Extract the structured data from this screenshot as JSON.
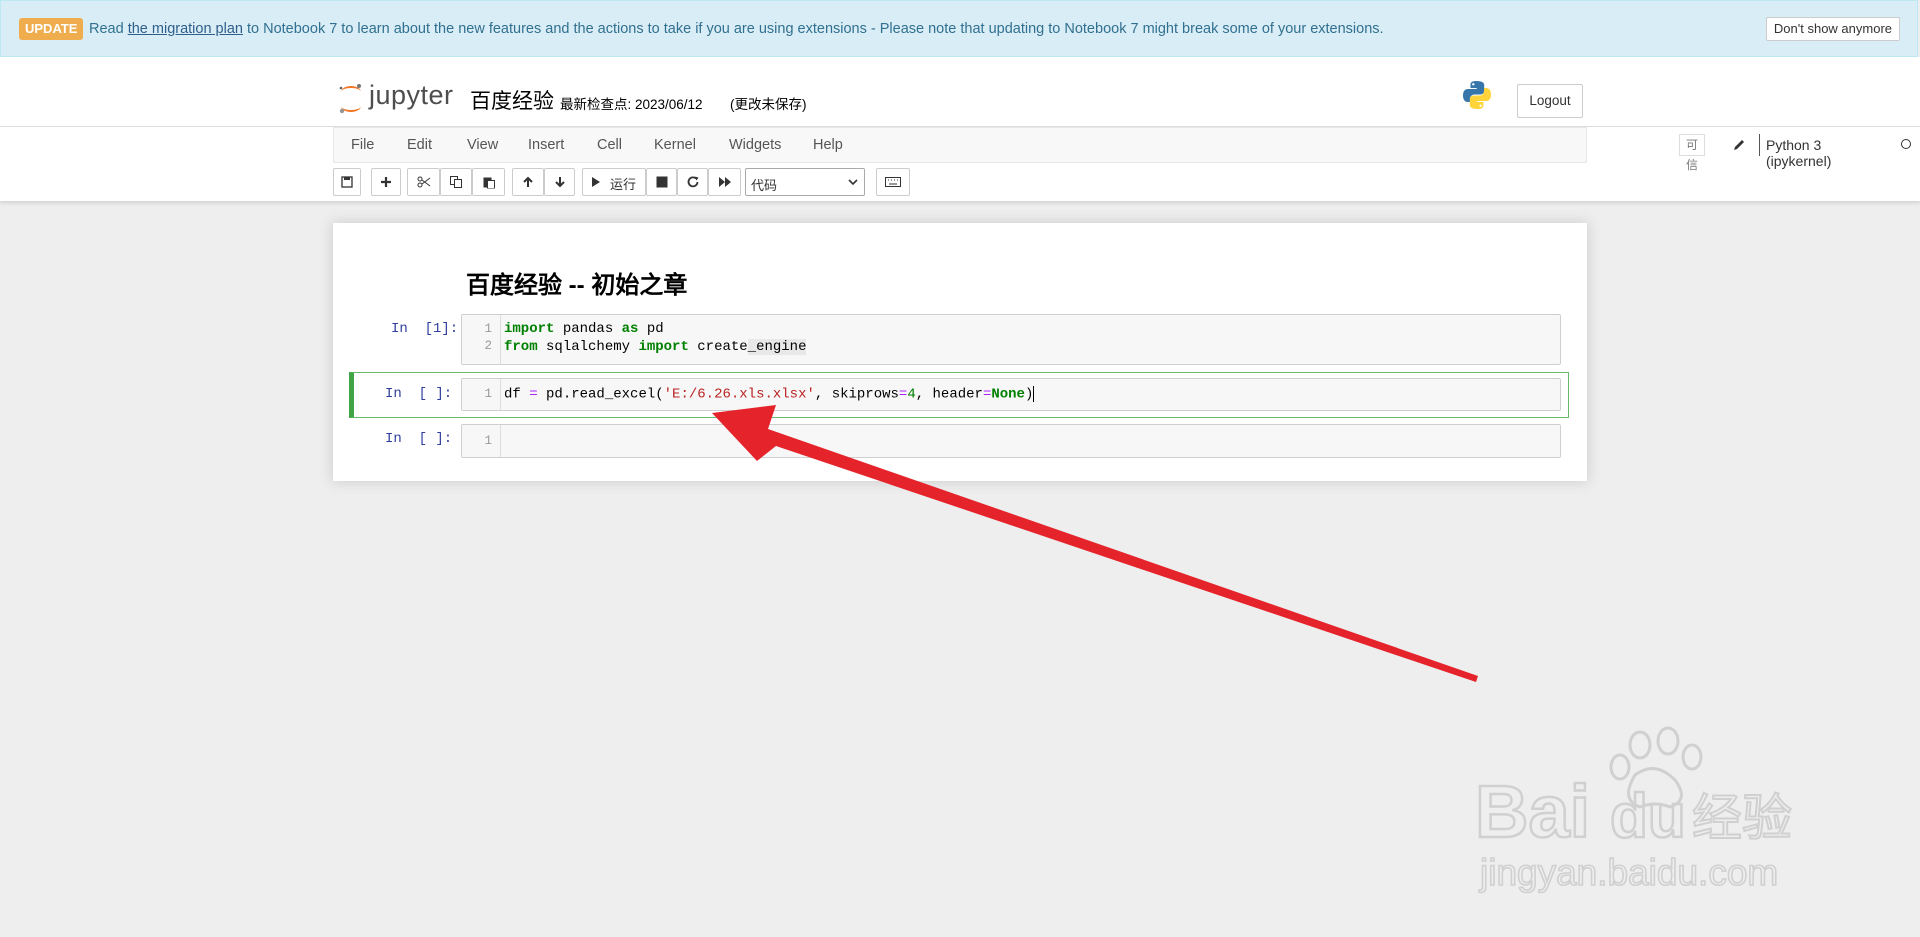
{
  "banner": {
    "badge": "UPDATE",
    "pre": "Read ",
    "link": "the migration plan",
    "post": " to Notebook 7 to learn about the new features and the actions to take if you are using extensions - Please note that updating to Notebook 7 might break some of your extensions.",
    "dismiss": "Don't show anymore"
  },
  "header": {
    "logo_text": "jupyter",
    "notebook_title": "百度经验",
    "checkpoint": "最新检查点: 2023/06/12",
    "unsaved": "(更改未保存)",
    "logout": "Logout"
  },
  "menu": {
    "items": [
      "File",
      "Edit",
      "View",
      "Insert",
      "Cell",
      "Kernel",
      "Widgets",
      "Help"
    ],
    "trusted": "可信",
    "kernel": "Python 3 (ipykernel)"
  },
  "toolbar": {
    "run_label": "运行",
    "cell_type": "代码"
  },
  "notebook": {
    "heading": "百度经验 -- 初始之章",
    "cells": [
      {
        "prompt": "In  [1]:",
        "lines": [
          "import pandas as pd",
          "from sqlalchemy import create_engine"
        ],
        "line_numbers": [
          "1",
          "2"
        ]
      },
      {
        "prompt": "In  [ ]:",
        "lines": [
          "df = pd.read_excel('E:/6.26.xls.xlsx', skiprows=4, header=None)"
        ],
        "line_numbers": [
          "1"
        ]
      },
      {
        "prompt": "In  [ ]:",
        "lines": [
          ""
        ],
        "line_numbers": [
          "1"
        ]
      }
    ]
  },
  "watermark": {
    "brand": "Bai du 经验",
    "url": "jingyan.baidu.com"
  },
  "colors": {
    "banner_bg": "#d9edf7",
    "badge": "#f0ad4e",
    "selected_cell": "#42a545",
    "prompt": "#303f9f",
    "arrow": "#e5232b"
  }
}
